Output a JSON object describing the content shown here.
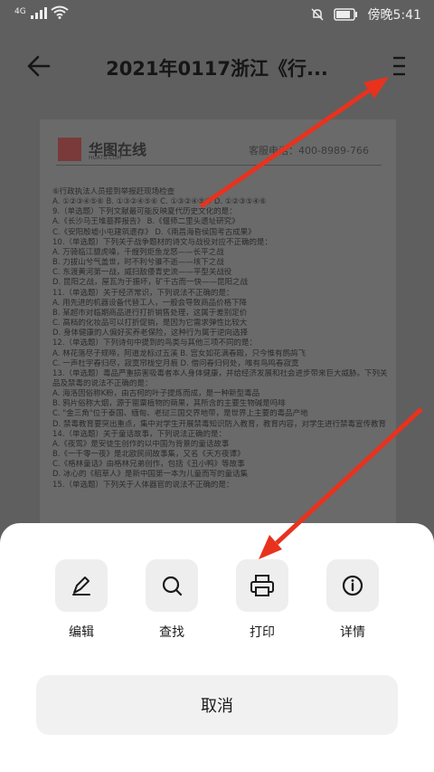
{
  "status_bar": {
    "network": "4G",
    "time": "傍晚5:41"
  },
  "app_bar": {
    "title": "2021年0117浙江《行...",
    "back_icon": "back-arrow-icon",
    "menu_icon": "more-menu-icon"
  },
  "document": {
    "brand": "华图在线",
    "brand_sub": "HUATU.COM",
    "hotline": "客服电话：400-8989-766",
    "lines": [
      "⑥行政执法人员接到举报赶现场检查",
      "A. ①②③④⑤⑥    B. ①③②④⑤⑥    C. ①③②④⑤⑥    D. ①②③⑤④⑥",
      "9.（单选题）下列文献最可能反映夏代历史文化的是：",
      "A.《长沙马王堆墓葬报告》            B.《偃师二里头遗址研究》",
      "C.《安阳殷墟小屯建筑遗存》          D.《南昌海昏侯国考古成果》",
      "10.（单选题）下列关于战争题材的诗文与战役对应不正确的是：",
      "A. 万骑临江貔虎噪，千艘列炬鱼龙怒——长平之战",
      "B. 力拔山兮气盖世，时不利兮骓不逝——垓下之战",
      "C. 东渡黄河第一战，威扫敌倭青史流——平型关战役",
      "D. 昆阳之战，屋瓦为于振坏，矿千古而一快——昆阳之战",
      "11.（单选题）关于经济常识，下列说法不正确的是：",
      "A. 用先进的机器设备代替工人，一般会导致商品价格下降",
      "B. 某超市对临期商品进行打折销售处理，这属于差别定价",
      "C. 高档的化妆品可以打折促销，是因为它需求弹性比较大",
      "D. 身体健康的人偏好买养老保险，这种行为属于逆向选择",
      "12.（单选题）下列诗句中提到的鸟类与其他三项不同的是：",
      "A. 林花落尽子规啼，阿道龙标过五溪        B. 宫女如花满春殿，只今惟有鹧鸪飞",
      "C. 一声杜宇春归尽，寂寞帘栊空月痕        D. 借问春归何处，唯有鸟鸣春寂寞",
      "13.（单选题）毒品严重损害吸毒者本人身体健康，并给经济发展和社会进步带来巨大威胁。下列关于毒",
      "品及禁毒的说法不正确的是：",
      "A. 海洛因俗称K粉，由古柯的叶子提炼而成，是一种新型毒品",
      "B. 鸦片俗称大烟，源于罂粟植物的蒴果，其所含的主要生物碱是吗啡",
      "C. \"金三角\"位于泰国、缅甸、老挝三国交界地带，是世界上主要的毒品产地",
      "D. 禁毒教育要突出重点，集中对学生开展禁毒知识防入教育，教育内容，对学生进行禁毒宣传教育",
      "14.（单选题）关于童话故事，下列说法正确的是：",
      "A.《夜莺》是安徒生创作的以中国为背景的童话故事",
      "B.《一千零一夜》是北欧民间故事集，又名《天方夜谭》",
      "C.《格林童话》由格林兄弟创作，包括《丑小鸭》等故事",
      "D. 冰心的《稻草人》是新中国第一本为儿童而写的童话集",
      "15.（单选题）下列关于人体器官的说法不正确的是："
    ]
  },
  "actions": [
    {
      "label": "编辑",
      "icon": "pencil-icon"
    },
    {
      "label": "查找",
      "icon": "search-icon"
    },
    {
      "label": "打印",
      "icon": "printer-icon"
    },
    {
      "label": "详情",
      "icon": "info-icon"
    }
  ],
  "cancel_label": "取消",
  "colors": {
    "scrim": "#5f5f5f",
    "sheet": "#ffffff",
    "tile": "#eeeeee",
    "annotation_arrow": "#e8321e"
  }
}
